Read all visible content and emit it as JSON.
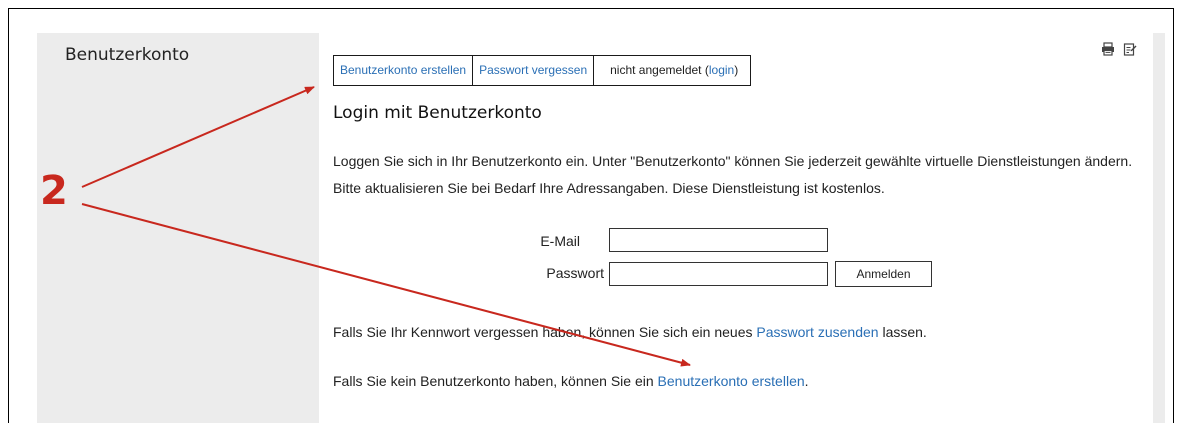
{
  "sidebar": {
    "title": "Benutzerkonto"
  },
  "tabs": {
    "create_account": "Benutzerkonto erstellen",
    "forgot_password": "Passwort vergessen",
    "status_prefix": "nicht angemeldet (",
    "status_login_link": "login",
    "status_suffix": ")"
  },
  "tools": {
    "print_icon": "printer-icon",
    "edit_icon": "edit-icon"
  },
  "main": {
    "heading": "Login mit Benutzerkonto",
    "intro": "Loggen Sie sich in Ihr Benutzerkonto ein. Unter \"Benutzerkonto\" können Sie jederzeit gewählte virtuelle Dienstleistungen ändern. Bitte aktualisieren Sie bei Bedarf Ihre Adressangaben. Diese Dienstleistung ist kostenlos."
  },
  "form": {
    "email_label": "E-Mail",
    "email_value": "",
    "password_label": "Passwort",
    "password_value": "",
    "submit_label": "Anmelden"
  },
  "forgot": {
    "text_before": "Falls Sie Ihr Kennwort vergessen haben, können Sie sich ein neues ",
    "link": "Passwort zusenden",
    "text_after": " lassen."
  },
  "no_account": {
    "text_before": "Falls Sie kein Benutzerkonto haben, können Sie ein ",
    "link": "Benutzerkonto erstellen",
    "text_after": "."
  },
  "annotation": {
    "number": "2",
    "color": "#c8281e"
  },
  "colors": {
    "link": "#2a6fb5",
    "sidebar_bg": "#ececec",
    "annotation": "#c8281e"
  }
}
